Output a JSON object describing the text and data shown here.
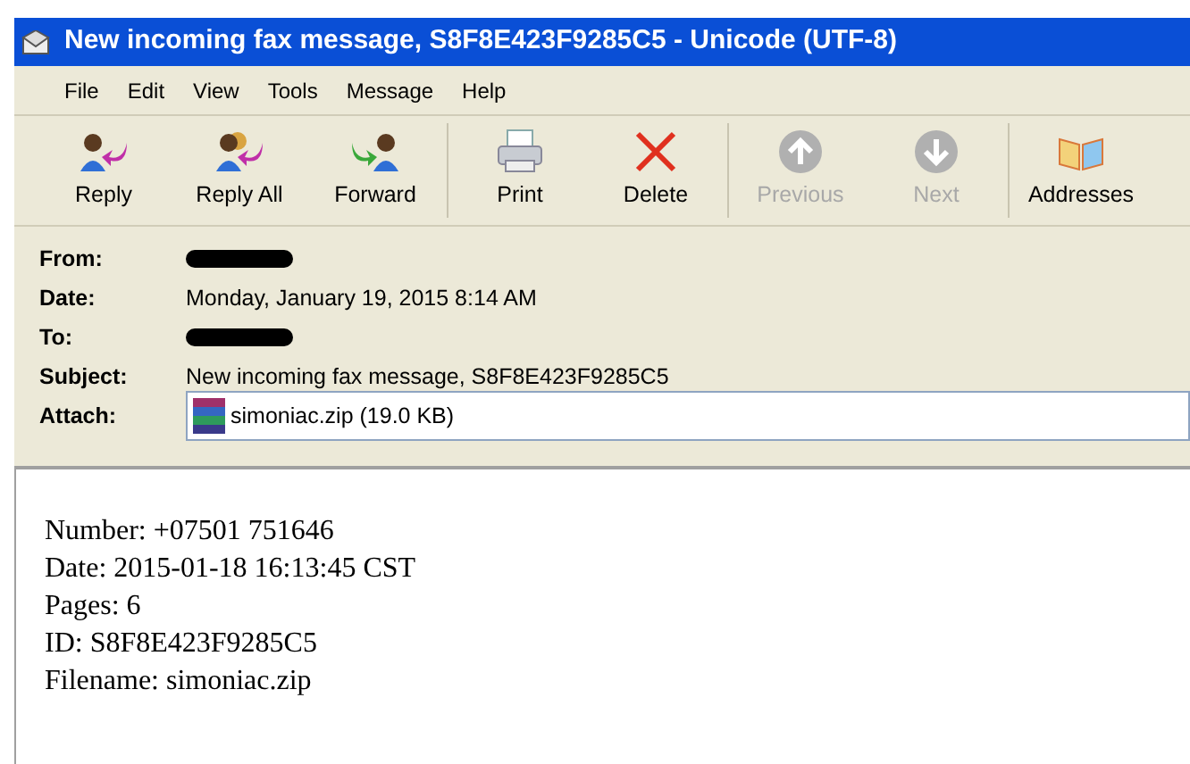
{
  "window": {
    "title": "New incoming fax message, S8F8E423F9285C5 - Unicode (UTF-8)"
  },
  "menu": [
    "File",
    "Edit",
    "View",
    "Tools",
    "Message",
    "Help"
  ],
  "toolbar": [
    {
      "label": "Reply",
      "kind": "reply",
      "disabled": false
    },
    {
      "label": "Reply All",
      "kind": "reply_all",
      "disabled": false
    },
    {
      "label": "Forward",
      "kind": "forward",
      "disabled": false
    },
    {
      "label": "Print",
      "kind": "print",
      "disabled": false
    },
    {
      "label": "Delete",
      "kind": "delete",
      "disabled": false
    },
    {
      "label": "Previous",
      "kind": "previous",
      "disabled": true
    },
    {
      "label": "Next",
      "kind": "next",
      "disabled": true
    },
    {
      "label": "Addresses",
      "kind": "addresses",
      "disabled": false
    }
  ],
  "headers": [
    {
      "label": "From:",
      "kind": "redacted"
    },
    {
      "label": "Date:",
      "kind": "text",
      "value": "Monday, January 19, 2015 8:14 AM"
    },
    {
      "label": "To:",
      "kind": "redacted"
    },
    {
      "label": "Subject:",
      "kind": "text",
      "value": "New incoming fax message, S8F8E423F9285C5"
    },
    {
      "label": "Attach:",
      "kind": "attachment",
      "value": "simoniac.zip (19.0 KB)"
    }
  ],
  "body": [
    "Number: +07501 751646",
    "Date: 2015-01-18 16:13:45 CST",
    "Pages: 6",
    "ID: S8F8E423F9285C5",
    "Filename: simoniac.zip"
  ]
}
